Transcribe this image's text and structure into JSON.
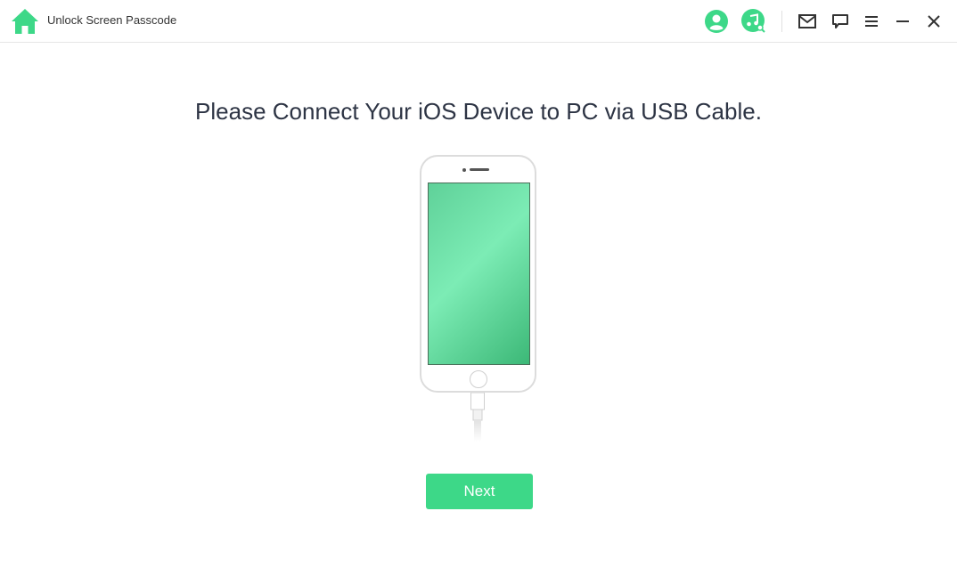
{
  "window": {
    "title": "Unlock Screen Passcode",
    "accent_color": "#3dd888"
  },
  "toolbar": {
    "icons": [
      "account-icon",
      "music-search-icon",
      "mail-icon",
      "feedback-icon",
      "menu-icon",
      "minimize-icon",
      "close-icon"
    ]
  },
  "main": {
    "headline": "Please Connect Your iOS Device to PC via USB Cable.",
    "next_label": "Next"
  }
}
